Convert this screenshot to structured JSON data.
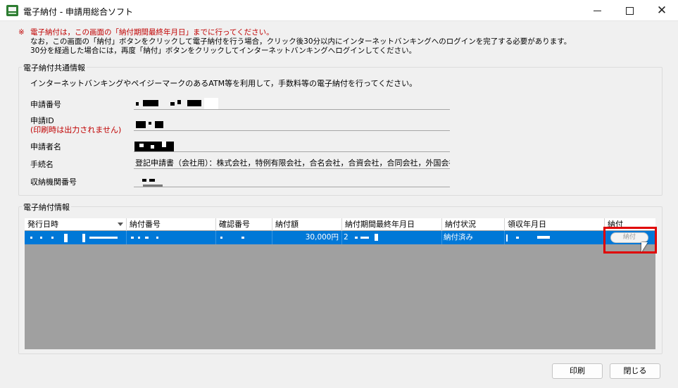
{
  "window": {
    "title": "電子納付 - 申請用総合ソフト",
    "controls": {
      "minimize": "—",
      "maximize": "□",
      "close": "✕"
    }
  },
  "notice": {
    "mark": "※",
    "line1": "電子納付は，この画面の「納付期間最終年月日」までに行ってください。",
    "line2": "なお，この画面の「納付」ボタンをクリックして電子納付を行う場合，クリック後30分以内にインターネットバンキングへのログインを完了する必要があります。",
    "line3": "30分を経過した場合には，再度「納付」ボタンをクリックしてインターネットバンキングへログインしてください。"
  },
  "common_info": {
    "title": "電子納付共通情報",
    "description": "インターネットバンキングやペイジーマークのあるATM等を利用して，手数料等の電子納付を行ってください。",
    "labels": {
      "application_number": "申請番号",
      "application_id": "申請ID",
      "application_id_note": "(印刷時は出力されません)",
      "applicant_name": "申請者名",
      "procedure_name": "手続名",
      "collection_agency_number": "収納機関番号"
    },
    "values": {
      "procedure_name": "登記申請書（会社用）：株式会社，特例有限会社，合名会社，合資会社，合同会社，外国会社"
    }
  },
  "payment_info": {
    "title": "電子納付情報",
    "columns": [
      "発行日時",
      "納付番号",
      "確認番号",
      "納付額",
      "納付期間最終年月日",
      "納付状況",
      "領収年月日",
      "納付"
    ],
    "rows": [
      {
        "amount": "30,000円",
        "deadline_prefix": "2",
        "status": "納付済み",
        "pay_button": "納付"
      }
    ]
  },
  "buttons": {
    "print": "印刷",
    "close": "閉じる"
  },
  "colors": {
    "selection": "#0078d7",
    "notice_red": "#c00000",
    "highlight_red": "#e00000"
  }
}
